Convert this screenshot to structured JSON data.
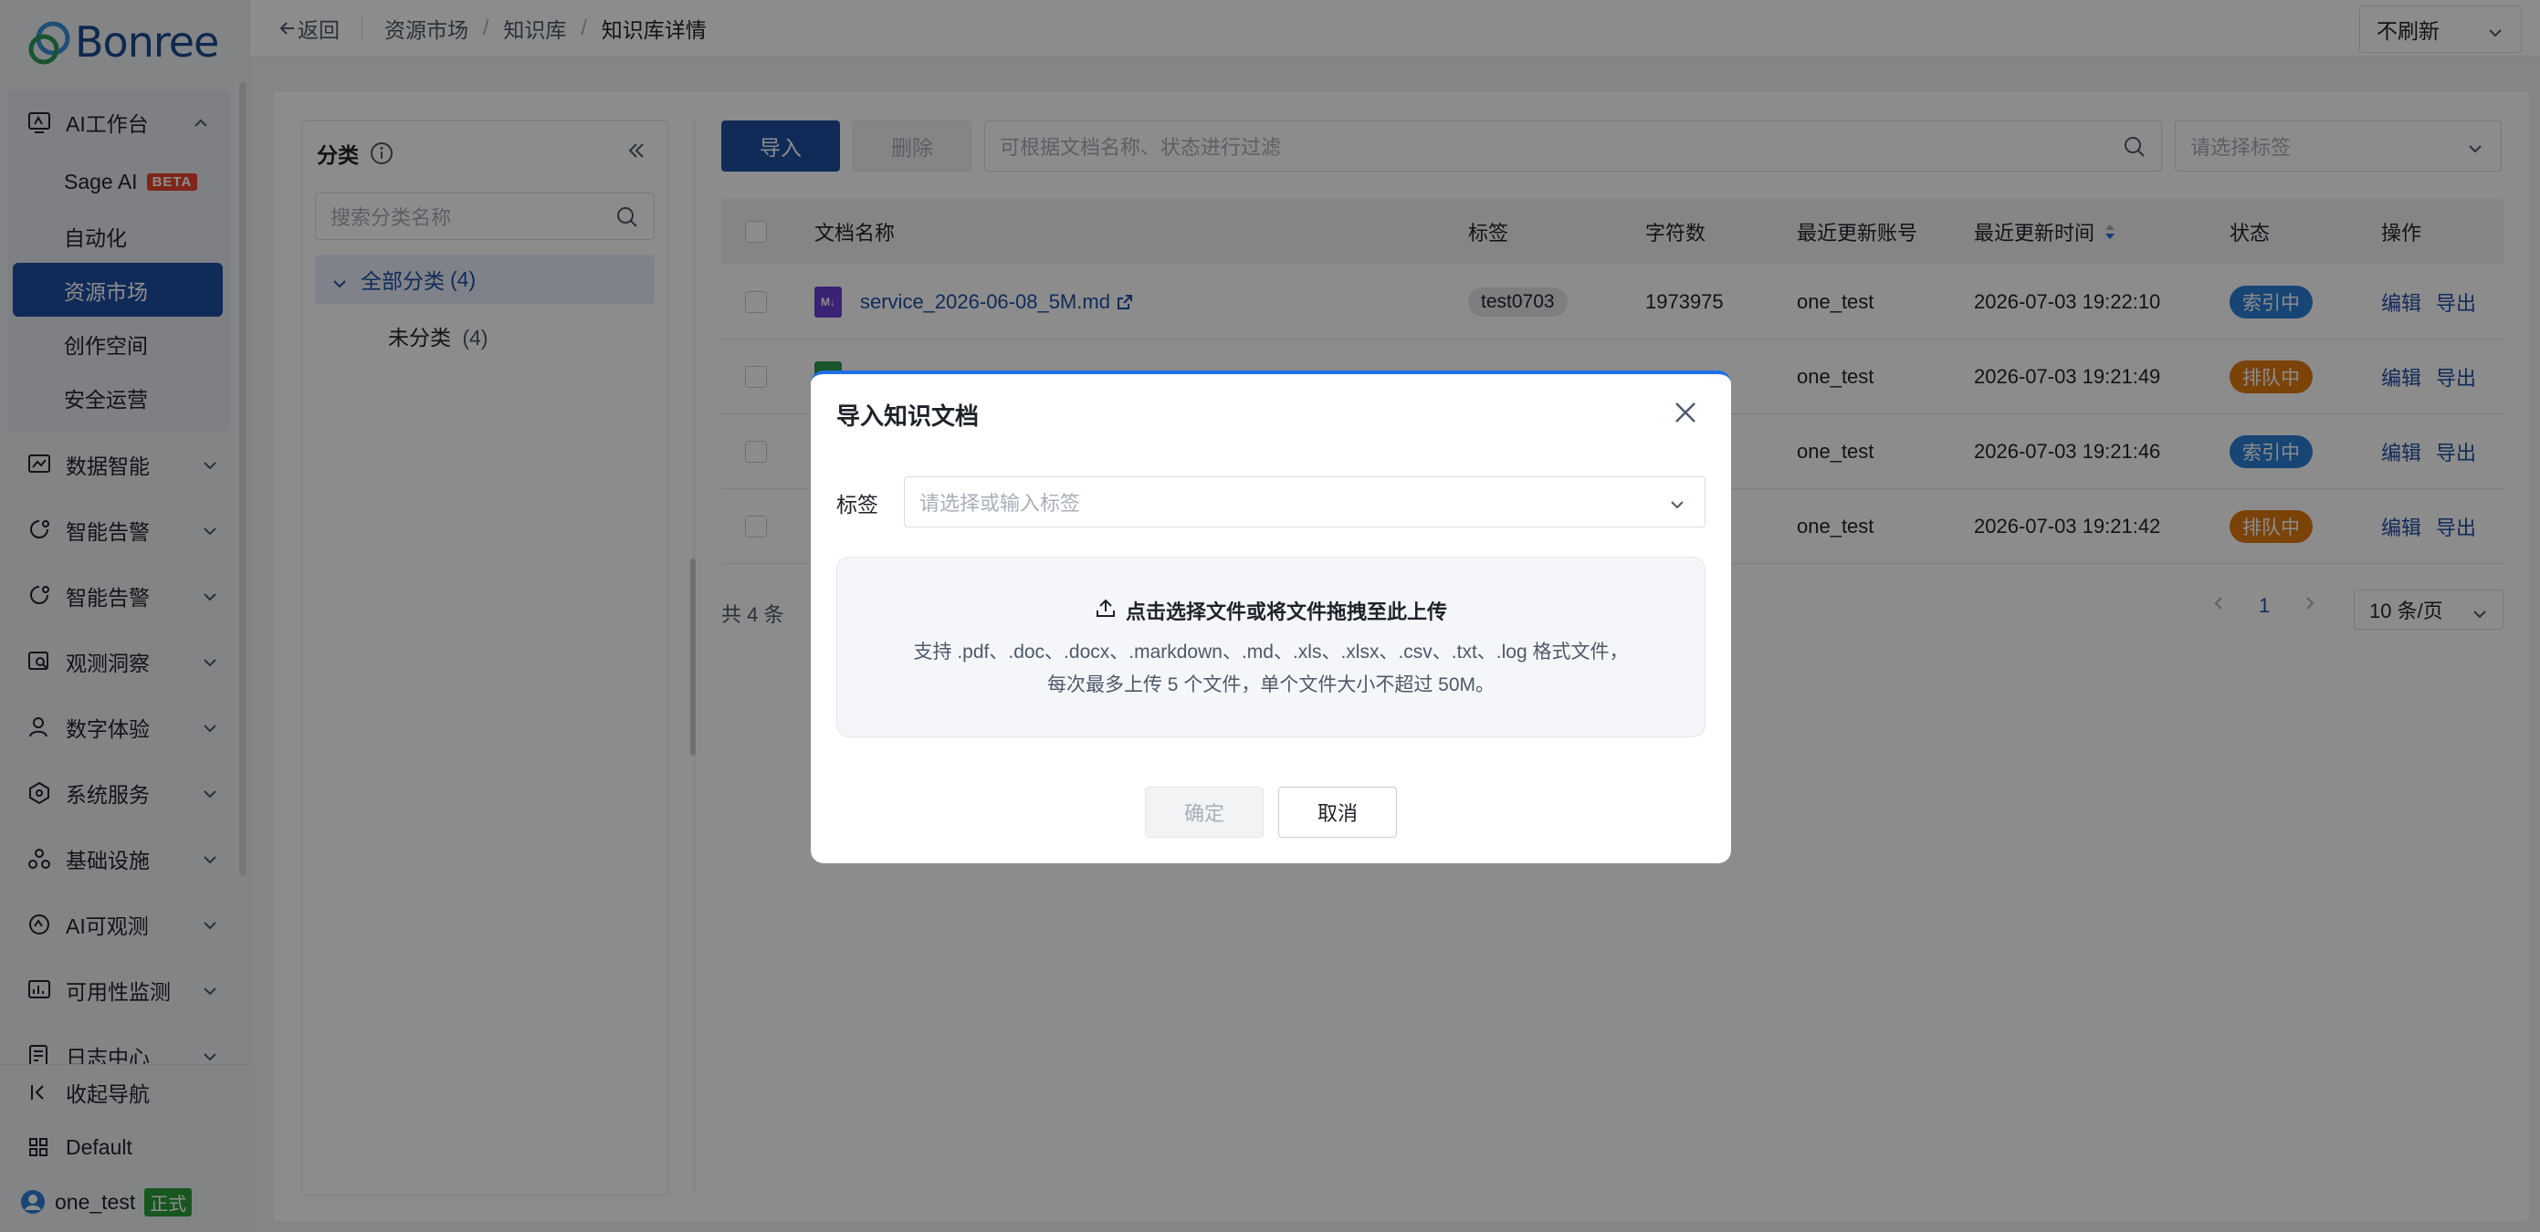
{
  "logo": {
    "text": "Bonree"
  },
  "sidebar": {
    "group": {
      "label": "AI工作台",
      "items": [
        {
          "label": "Sage AI",
          "badge": "BETA"
        },
        {
          "label": "自动化"
        },
        {
          "label": "资源市场",
          "active": true
        },
        {
          "label": "创作空间"
        },
        {
          "label": "安全运营"
        }
      ]
    },
    "items": [
      {
        "label": "数据智能",
        "icon": "chart-icon"
      },
      {
        "label": "智能告警",
        "icon": "alert-icon"
      },
      {
        "label": "智能告警",
        "icon": "alert-icon"
      },
      {
        "label": "观测洞察",
        "icon": "insight-icon"
      },
      {
        "label": "数字体验",
        "icon": "user-icon"
      },
      {
        "label": "系统服务",
        "icon": "service-icon"
      },
      {
        "label": "基础设施",
        "icon": "infra-icon"
      },
      {
        "label": "AI可观测",
        "icon": "ai-observe-icon"
      },
      {
        "label": "可用性监测",
        "icon": "monitor-icon"
      },
      {
        "label": "日志中心",
        "icon": "log-icon"
      }
    ],
    "bottom": {
      "collapse": "收起导航",
      "workspace": "Default",
      "user": "one_test",
      "user_badge": "正式"
    }
  },
  "topbar": {
    "back": "返回",
    "breadcrumb": [
      "资源市场",
      "知识库",
      "知识库详情"
    ],
    "separator": "/",
    "refresh": "不刷新"
  },
  "category": {
    "title": "分类",
    "search_placeholder": "搜索分类名称",
    "all": {
      "label": "全部分类",
      "count": "(4)"
    },
    "uncat": {
      "label": "未分类",
      "count": "(4)"
    }
  },
  "toolbar": {
    "import": "导入",
    "delete": "删除",
    "filter_placeholder": "可根据文档名称、状态进行过滤",
    "tag_placeholder": "请选择标签"
  },
  "table": {
    "columns": [
      "文档名称",
      "标签",
      "字符数",
      "最近更新账号",
      "最近更新时间",
      "状态",
      "操作"
    ],
    "rows": [
      {
        "name": "service_2026-06-08_5M.md",
        "tag": "test0703",
        "chars": "1973975",
        "account": "one_test",
        "time": "2026-07-03 19:22:10",
        "status": "索引中",
        "status_color": "#2b7fd6",
        "file_color": "#6b3fd4"
      },
      {
        "name": "",
        "tag": "",
        "chars": "",
        "account": "one_test",
        "time": "2026-07-03 19:21:49",
        "status": "排队中",
        "status_color": "#e07a10",
        "file_color": "#2e9d4f"
      },
      {
        "name": "",
        "tag": "",
        "chars": "",
        "account": "one_test",
        "time": "2026-07-03 19:21:46",
        "status": "索引中",
        "status_color": "#2b7fd6",
        "file_color": ""
      },
      {
        "name": "",
        "tag": "",
        "chars": "",
        "account": "one_test",
        "time": "2026-07-03 19:21:42",
        "status": "排队中",
        "status_color": "#e07a10",
        "file_color": ""
      }
    ],
    "actions": {
      "edit": "编辑",
      "export": "导出"
    }
  },
  "pagination": {
    "total": "共 4 条",
    "page": "1",
    "size": "10 条/页"
  },
  "modal": {
    "title": "导入知识文档",
    "tag_label": "标签",
    "tag_placeholder": "请选择或输入标签",
    "upload_title": "点击选择文件或将文件拖拽至此上传",
    "upload_desc1": "支持 .pdf、.doc、.docx、.markdown、.md、.xls、.xlsx、.csv、.txt、.log 格式文件，",
    "upload_desc2": "每次最多上传 5 个文件，单个文件大小不超过 50M。",
    "ok": "确定",
    "cancel": "取消"
  },
  "colors": {
    "primary": "#1f4fa3",
    "indexing": "#2b7fd6",
    "queued": "#e07a10",
    "modal_accent": "#1f6fe8"
  }
}
